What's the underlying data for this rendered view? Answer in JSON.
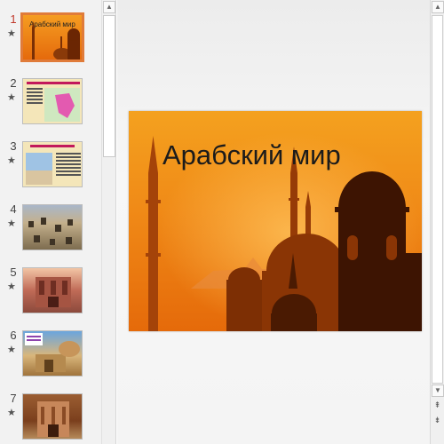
{
  "slides": [
    {
      "number": "1",
      "marker": "★",
      "thumb_title": "Арабский мир"
    },
    {
      "number": "2",
      "marker": "★"
    },
    {
      "number": "3",
      "marker": "★"
    },
    {
      "number": "4",
      "marker": "★"
    },
    {
      "number": "5",
      "marker": "★"
    },
    {
      "number": "6",
      "marker": "★"
    },
    {
      "number": "7",
      "marker": "★"
    }
  ],
  "current_slide": {
    "title": "Арабский мир"
  },
  "scrollbar": {
    "up_arrow": "▲",
    "down_arrow": "▼",
    "prev_slide": "⇞",
    "next_slide": "⇟"
  },
  "colors": {
    "selection": "#e07b39",
    "slide_background": "#f28a1f"
  }
}
